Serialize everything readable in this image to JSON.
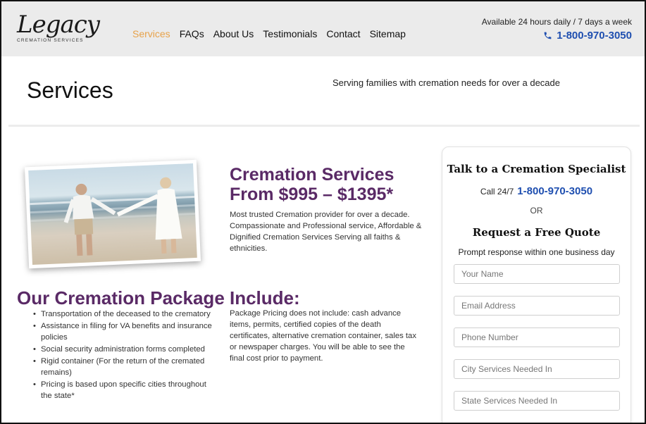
{
  "header": {
    "logo_script": "Legacy",
    "logo_sub": "CREMATION SERVICES",
    "nav": [
      {
        "label": "Services",
        "active": true
      },
      {
        "label": "FAQs",
        "active": false
      },
      {
        "label": "About Us",
        "active": false
      },
      {
        "label": "Testimonials",
        "active": false
      },
      {
        "label": "Contact",
        "active": false
      },
      {
        "label": "Sitemap",
        "active": false
      }
    ],
    "availability": "Available 24 hours daily / 7 days a week",
    "phone": "1-800-970-3050",
    "phone_icon": "phone-icon"
  },
  "page": {
    "title": "Services",
    "tagline": "Serving families with cremation needs for over a decade"
  },
  "services": {
    "heading_line1": "Cremation Services",
    "heading_line2": "From $995 – $1395*",
    "description": "Most trusted Cremation provider for over a decade. Compassionate and Professional service, Affordable & Dignified Cremation Services Serving all faiths & ethnicities."
  },
  "package": {
    "heading": "Our Cremation Package Include:",
    "items": [
      "Transportation of the deceased to the crematory",
      "Assistance in filing for VA benefits and insurance policies",
      "Social security administration forms completed",
      "Rigid container (For the return of the cremated remains)",
      "Pricing is based upon specific cities throughout the state*"
    ],
    "note": "Package Pricing does not include: cash advance items, permits, certified copies of the death certificates, alternative cremation container, sales tax or newspaper charges. You will be able to see the final cost prior to payment."
  },
  "sidebar": {
    "title": "Talk to a Cremation Specialist",
    "call_label": "Call 24/7",
    "phone": "1-800-970-3050",
    "or": "OR",
    "quote_title": "Request a Free Quote",
    "quote_sub": "Prompt response within one business day",
    "fields": {
      "name": "Your Name",
      "email": "Email Address",
      "phone": "Phone Number",
      "city": "City Services Needed In",
      "state": "State Services Needed In"
    }
  },
  "colors": {
    "accent_purple": "#5a2a66",
    "nav_active": "#e7a24a",
    "phone_blue": "#1f4fb0",
    "header_bg": "#ebebeb"
  }
}
